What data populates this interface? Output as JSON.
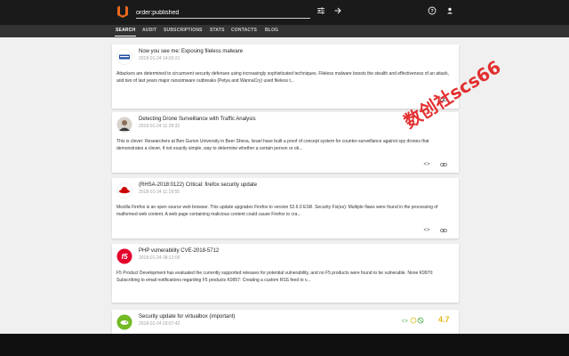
{
  "header": {
    "search_value": "order:published",
    "icons": [
      "logo-icon",
      "filter-sliders-icon",
      "arrow-right-icon",
      "help-icon",
      "user-icon"
    ]
  },
  "nav": {
    "items": [
      "SEARCH",
      "AUDIT",
      "SUBSCRIPTIONS",
      "STATS",
      "CONTACTS",
      "BLOG"
    ],
    "active": "SEARCH"
  },
  "results": [
    {
      "title": "Now you see me: Exposing fileless malware",
      "date": "2018-01-24 14:00:21",
      "body": "Attackers are determined to circumvent security defenses using increasingly sophisticated techniques. Fileless malware boosts the stealth and effectiveness of an attack, and two of last years major ransomware outbreaks (Petya and WannaCry) used fileless t...",
      "icon": "microsoft-logo-icon",
      "accent": "#1f4ea1"
    },
    {
      "title": "Detecting Drone Surveillance with Traffic Analysis",
      "date": "2018-01-24 11:28:32",
      "body": "This is clever: Researchers at Ben Gurion University in Beer Sheva, Israel have built a proof of concept system for counter-surveillance against spy drones that demonstrates a clever, if not exactly simple, way to determine whether a certain person or ob...",
      "icon": "author-avatar-icon",
      "accent": "#6b6b6b"
    },
    {
      "title": "(RHSA-2018:0122) Critical: firefox security update",
      "date": "2018-01-24 11:19:55",
      "body": "Mozilla Firefox is an open source web browser. This update upgrades Firefox to version 52.6.0 ESR. Security Fix(es): Multiple flaws were found in the processing of malformed web content. A web page containing malicious content could cause Firefox to cra...",
      "icon": "redhat-logo-icon",
      "accent": "#cc0000"
    },
    {
      "title": "PHP vulnerability CVE-2018-5712",
      "date": "2018-01-24 08:12:00",
      "body": "F5 Product Development has evaluated the currently supported releases for potential vulnerability, and no F5 products were found to be vulnerable. None K9970: Subscribing to email notifications regarding F5 products K9957: Creating a custom RSS feed to v...",
      "icon": "f5-logo-icon",
      "accent": "#e4002b"
    },
    {
      "title": "Security update for virtualbox (important)",
      "date": "2018-01-24 03:07:42",
      "body": "",
      "icon": "suse-logo-icon",
      "accent": "#73ba25",
      "score": "4.7"
    }
  ],
  "actions": {
    "code": "<>",
    "link": "link-icon"
  },
  "watermark": "数创社scs66"
}
